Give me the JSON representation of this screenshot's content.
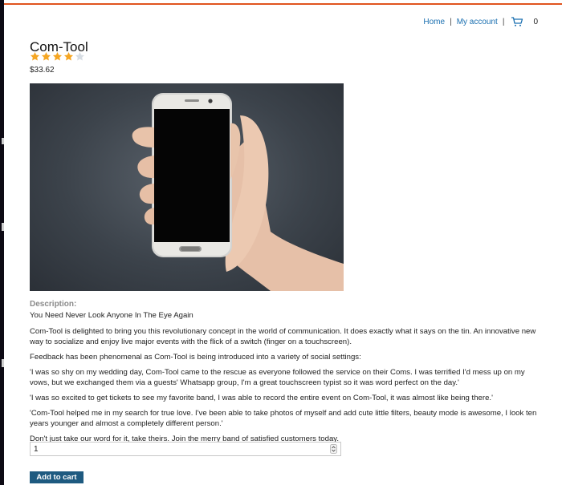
{
  "nav": {
    "home": "Home",
    "separator": "|",
    "my_account": "My account",
    "cart_icon": "cart-icon",
    "cart_count": "0"
  },
  "product": {
    "title": "Com-Tool",
    "rating": 4,
    "rating_max": 5,
    "price": "$33.62",
    "image": "hand holding smartphone"
  },
  "description": {
    "label": "Description:",
    "tagline": "You Need Never Look Anyone In The Eye Again",
    "paragraphs": [
      "Com-Tool is delighted to bring you this revolutionary concept in the world of communication. It does exactly what it says on the tin. An innovative new way to socialize and enjoy live major events with the flick of a switch (finger on a touchscreen).",
      "Feedback has been phenomenal as Com-Tool is being introduced into a variety of social settings:",
      "'I was so shy on my wedding day, Com-Tool came to the rescue as everyone followed the service on their Coms. I was terrified I'd mess up on my vows, but we exchanged them via a guests' Whatsapp group, I'm a great touchscreen typist so it was word perfect on the day.'",
      "'I was so excited to get tickets to see my favorite band, I was able to record the entire event on Com-Tool, it was almost like being there.'",
      "'Com-Tool helped me in my search for true love. I've been able to take photos of myself and add cute little filters, beauty mode is awesome, I look ten years younger and almost a completely different person.'",
      "Don't just take our word for it, take theirs. Join the merry band of satisfied customers today."
    ]
  },
  "quantity": {
    "value": "1"
  },
  "actions": {
    "add_to_cart": "Add to cart"
  },
  "colors": {
    "accent_line": "#e0541e",
    "link": "#1a6fb0",
    "button": "#1e5a80",
    "star_filled": "#f5a623",
    "star_empty": "#d7dde3"
  }
}
